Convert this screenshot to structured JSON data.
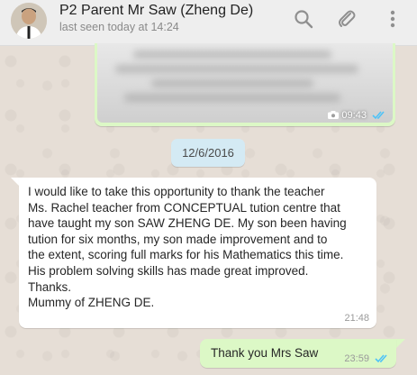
{
  "header": {
    "title": "P2 Parent Mr Saw (Zheng De)",
    "subtitle": "last seen today at 14:24",
    "icons": [
      "search-icon",
      "attach-icon",
      "menu-icon"
    ]
  },
  "messages": {
    "image_message": {
      "time": "09:43",
      "status": "read"
    },
    "date_chip": "12/6/2016",
    "incoming": {
      "text": "I would like to take this opportunity to thank the teacher\nMs. Rachel teacher from CONCEPTUAL tution centre that\nhave taught my son SAW ZHENG DE. My son been having\ntution for six months,  my son made improvement and to\nthe extent,  scoring full marks for his Mathematics this time.\nHis problem solving skills has made great improved.\nThanks.\nMummy of ZHENG DE.",
      "time": "21:48"
    },
    "outgoing": {
      "text": "Thank you Mrs Saw",
      "time": "23:59",
      "status": "read"
    }
  },
  "colors": {
    "header_bg": "#eeeeee",
    "chat_bg": "#e5ddd5",
    "outgoing_bubble": "#dcf8c6",
    "incoming_bubble": "#ffffff",
    "date_chip": "#d4eaf4",
    "read_tick": "#4fc3f7"
  }
}
